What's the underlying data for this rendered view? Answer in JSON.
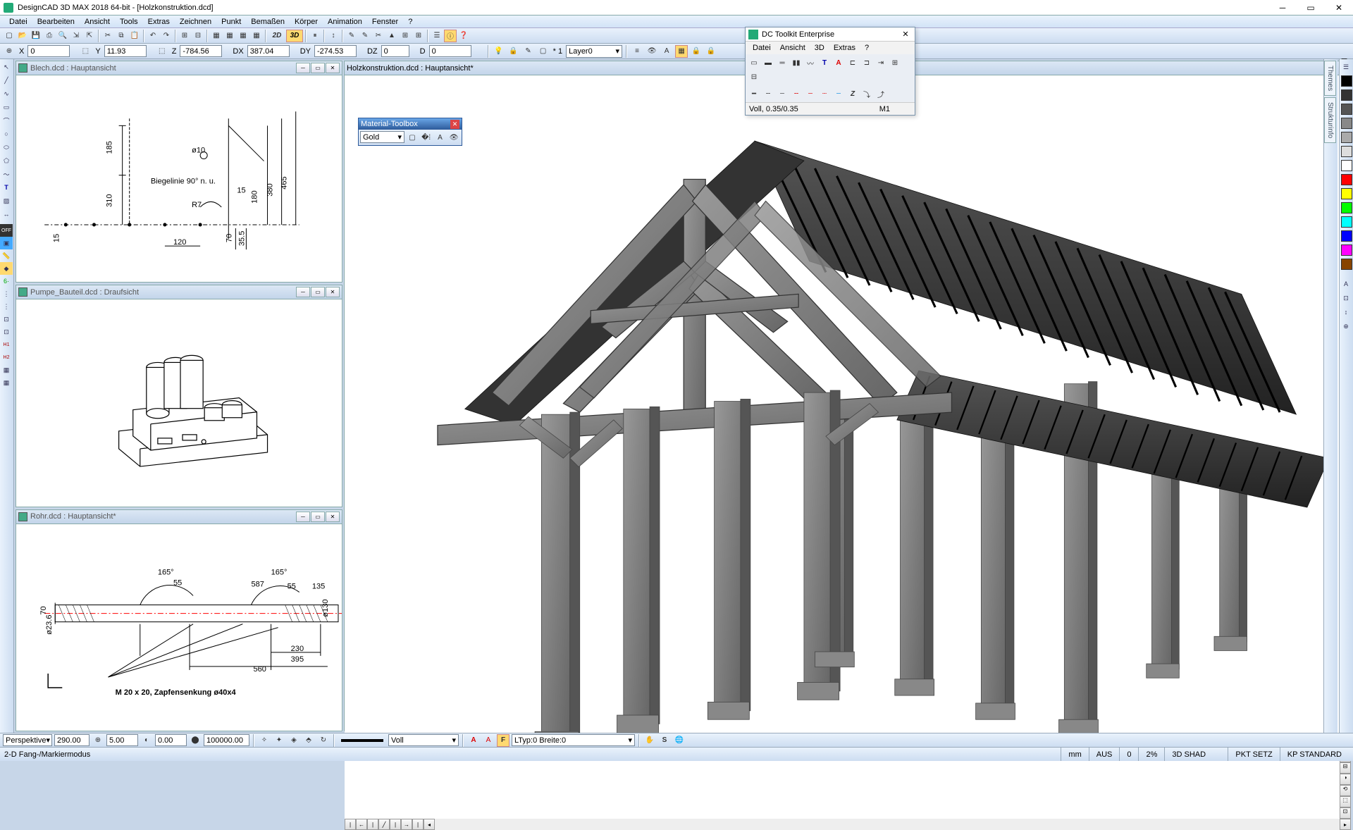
{
  "app": {
    "title": "DesignCAD 3D MAX 2018 64-bit - [Holzkonstruktion.dcd]"
  },
  "menu": [
    "Datei",
    "Bearbeiten",
    "Ansicht",
    "Tools",
    "Extras",
    "Zeichnen",
    "Punkt",
    "Bemaßen",
    "Körper",
    "Animation",
    "Fenster",
    "?"
  ],
  "coords": {
    "x_label": "X",
    "x": "0",
    "y_label": "Y",
    "y": "11.93",
    "z_label": "Z",
    "z": "-784.56",
    "dx_label": "DX",
    "dx": "387.04",
    "dy_label": "DY",
    "dy": "-274.53",
    "dz_label": "DZ",
    "dz": "0",
    "d_label": "D",
    "d": "0",
    "layer_prefix": "*  1",
    "layer": "Layer0"
  },
  "tb1": {
    "mode2d": "2D",
    "mode3d": "3D"
  },
  "docs": {
    "d1": "Blech.dcd : Hauptansicht",
    "d2": "Pumpe_Bauteil.dcd : Draufsicht",
    "d3": "Rohr.dcd : Hauptansicht*",
    "main": "Holzkonstruktion.dcd : Hauptansicht*"
  },
  "drawing1": {
    "dim185": "185",
    "dim310": "310",
    "diam": "ø10",
    "biege": "Biegelinie 90° n. u.",
    "d15": "15",
    "d180": "180",
    "d380": "380",
    "d465": "465",
    "r7": "R7",
    "d120": "120",
    "d15b": "15",
    "d70": "70",
    "d355": "35.5"
  },
  "drawing3": {
    "ang165a": "165°",
    "ang165b": "165°",
    "d55a": "55",
    "d587": "587",
    "d55b": "55",
    "d135": "135",
    "d70": "70",
    "d236": "ø23.6",
    "d130": "ø130",
    "d395": "395",
    "d560": "560",
    "d230": "230",
    "note": "M 20 x 20, Zapfensenkung ø40x4"
  },
  "dctoolkit": {
    "title": "DC Toolkit Enterprise",
    "menu": [
      "Datei",
      "Ansicht",
      "3D",
      "Extras",
      "?"
    ],
    "status_left": "Voll, 0.35/0.35",
    "status_right": "M1"
  },
  "material": {
    "title": "Material-Toolbox",
    "value": "Gold"
  },
  "bottom": {
    "perspektive": "Perspektive",
    "v1": "290.00",
    "v2": "5.00",
    "v3": "0.00",
    "v4": "100000.00",
    "voll": "Voll",
    "ltyp": "LTyp:0  Breite:0"
  },
  "status": {
    "mode": "2-D Fang-/Markiermodus",
    "mm": "mm",
    "aus": "AUS",
    "zero": "0",
    "pct": "2%",
    "shad": "3D SHAD",
    "pkt": "PKT SETZ",
    "kp": "KP STANDARD"
  },
  "righttabs": {
    "themes": "Themes",
    "struktur": "Strukturinfo"
  },
  "colors": [
    "#000",
    "#333",
    "#555",
    "#888",
    "#aaa",
    "#ddd",
    "#fff",
    "#f00",
    "#ff0",
    "#0f0",
    "#0ff",
    "#00f",
    "#f0f",
    "#840"
  ]
}
